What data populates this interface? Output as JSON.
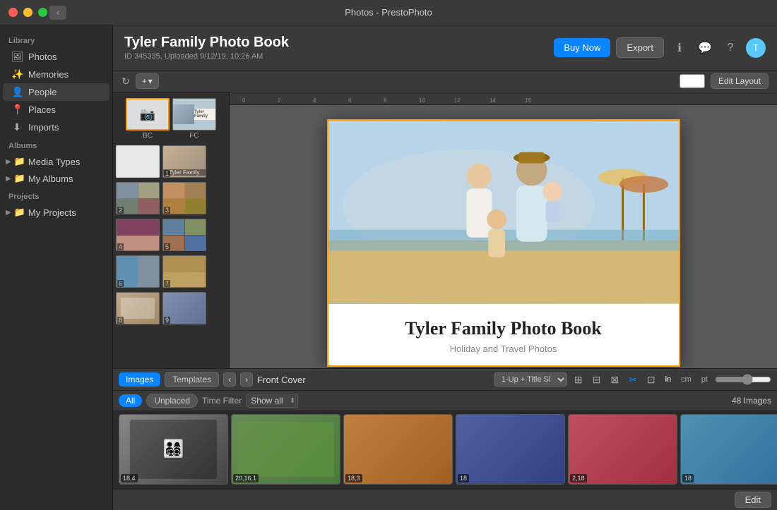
{
  "titlebar": {
    "title": "Photos - PrestoPhoto"
  },
  "sidebar": {
    "library_label": "Library",
    "items": [
      {
        "id": "photos",
        "label": "Photos",
        "icon": "🖼"
      },
      {
        "id": "memories",
        "label": "Memories",
        "icon": "✨"
      },
      {
        "id": "people",
        "label": "People",
        "icon": "👤"
      },
      {
        "id": "places",
        "label": "Places",
        "icon": "📍"
      },
      {
        "id": "imports",
        "label": "Imports",
        "icon": "⬇"
      }
    ],
    "albums_label": "Albums",
    "albums": [
      {
        "id": "media-types",
        "label": "Media Types"
      },
      {
        "id": "my-albums",
        "label": "My Albums"
      }
    ],
    "projects_label": "Projects",
    "projects": [
      {
        "id": "my-projects",
        "label": "My Projects"
      }
    ]
  },
  "header": {
    "title": "Tyler Family Photo Book",
    "subtitle": "ID 345335, Uploaded 9/12/19, 10:26 AM",
    "buy_now": "Buy Now",
    "export": "Export",
    "edit_layout": "Edit Layout"
  },
  "canvas": {
    "page_title": "Tyler Family Photo Book",
    "page_subtitle": "Holiday and Travel Photos",
    "current_page": "Front Cover"
  },
  "bottom_toolbar": {
    "tab_images": "Images",
    "tab_templates": "Templates",
    "nav_prev": "‹",
    "nav_next": "›",
    "view_mode": "1-Up + Title Sl",
    "unit_in": "in",
    "unit_cm": "cm",
    "unit_pt": "pt"
  },
  "filter_bar": {
    "all": "All",
    "unplaced": "Unplaced",
    "time_filter": "Time Filter",
    "show_all": "Show all",
    "image_count": "48 Images"
  },
  "page_strip": {
    "covers": {
      "bc": "BC",
      "fc": "FC"
    },
    "pages": [
      {
        "num": "1",
        "left": "",
        "right": "1"
      },
      {
        "num": "2",
        "left": "2",
        "right": "3"
      },
      {
        "num": "3",
        "left": "4",
        "right": "5"
      },
      {
        "num": "4",
        "left": "6",
        "right": "7"
      },
      {
        "num": "5",
        "left": "8",
        "right": "9"
      }
    ]
  },
  "photo_strip": {
    "photos": [
      {
        "label": "18,4",
        "color": "#555"
      },
      {
        "label": "20,16,1",
        "color": "#6a8a5a"
      },
      {
        "label": "18,3",
        "color": "#c08040"
      },
      {
        "label": "18",
        "color": "#5060a0"
      },
      {
        "label": "2,18",
        "color": "#c05060"
      },
      {
        "label": "18",
        "color": "#5090b0"
      }
    ]
  },
  "actions": {
    "edit": "Edit"
  }
}
